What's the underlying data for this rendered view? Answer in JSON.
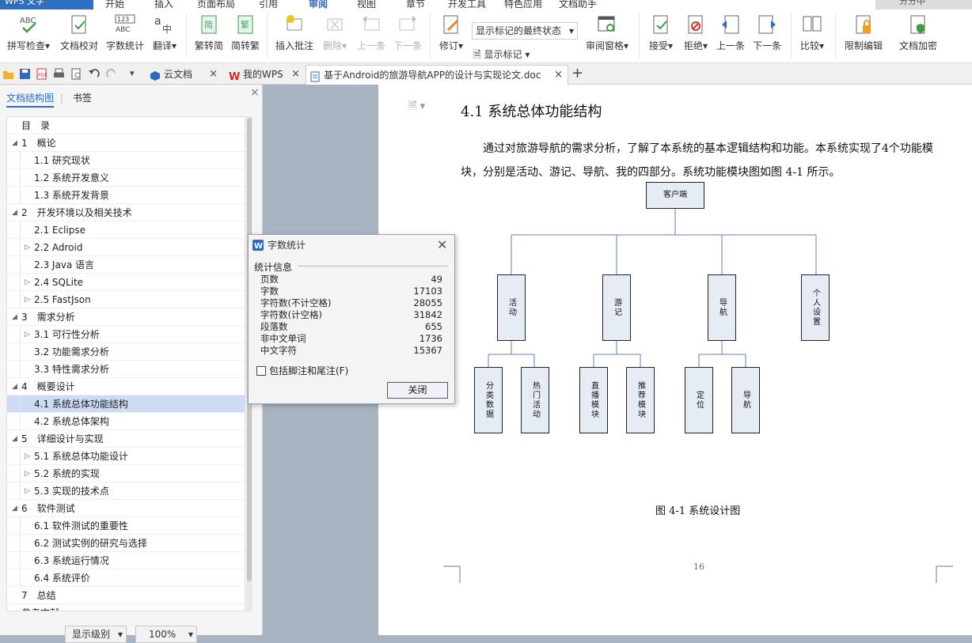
{
  "menubar": {
    "app_name": "WPS 文字",
    "tabs": [
      "开始",
      "插入",
      "页面布局",
      "引用",
      "审阅",
      "视图",
      "章节",
      "开发工具",
      "特色应用",
      "文档助手"
    ],
    "active_tab": "审阅",
    "user": "分分中"
  },
  "ribbon": {
    "spell_check": "拼写检查",
    "doc_proof": "文档校对",
    "word_count": "字数统计",
    "translate": "翻译",
    "to_traditional": "繁转简",
    "to_simplified": "简转繁",
    "insert_comment": "插入批注",
    "delete": "删除",
    "prev": "上一条",
    "next": "下一条",
    "revise": "修订",
    "markup_state": "显示标记的最终状态",
    "show_markup": "显示标记",
    "review_pane": "审阅窗格",
    "accept": "接受",
    "reject": "拒绝",
    "prev2": "上一条",
    "next2": "下一条",
    "compare": "比较",
    "restrict_edit": "限制编辑",
    "doc_encrypt": "文档加密"
  },
  "tabs": [
    {
      "label": "云文档",
      "close": "×"
    },
    {
      "label": "我的WPS",
      "close": "×"
    },
    {
      "label": "基于Android的旅游导航APP的设计与实现论文.doc",
      "close": "×"
    }
  ],
  "new_tab": "+",
  "nav": {
    "tab_outline": "文档结构图",
    "tab_bookmark": "书签",
    "close": "×",
    "items": [
      {
        "level": 0,
        "arrow": "",
        "label": "目　录"
      },
      {
        "level": 0,
        "arrow": "◢",
        "label": "1　概论"
      },
      {
        "level": 1,
        "arrow": "",
        "label": "1.1  研究现状"
      },
      {
        "level": 1,
        "arrow": "",
        "label": "1.2  系统开发意义"
      },
      {
        "level": 1,
        "arrow": "",
        "label": "1.3  系统开发背景"
      },
      {
        "level": 0,
        "arrow": "◢",
        "label": "2　开发环境以及相关技术"
      },
      {
        "level": 1,
        "arrow": "",
        "label": "2.1 Eclipse"
      },
      {
        "level": 1,
        "arrow": "▷",
        "label": "2.2 Adroid"
      },
      {
        "level": 1,
        "arrow": "",
        "label": "2.3 Java 语言"
      },
      {
        "level": 1,
        "arrow": "▷",
        "label": "2.4 SQLite"
      },
      {
        "level": 1,
        "arrow": "▷",
        "label": "2.5 FastJson"
      },
      {
        "level": 0,
        "arrow": "◢",
        "label": "3　需求分析"
      },
      {
        "level": 1,
        "arrow": "▷",
        "label": "3.1  可行性分析"
      },
      {
        "level": 1,
        "arrow": "",
        "label": "3.2  功能需求分析"
      },
      {
        "level": 1,
        "arrow": "",
        "label": "3.3  特性需求分析"
      },
      {
        "level": 0,
        "arrow": "◢",
        "label": "4　概要设计"
      },
      {
        "level": 1,
        "arrow": "",
        "label": "4.1  系统总体功能结构",
        "selected": true
      },
      {
        "level": 1,
        "arrow": "",
        "label": "4.2  系统总体架构"
      },
      {
        "level": 0,
        "arrow": "◢",
        "label": "5　详细设计与实现"
      },
      {
        "level": 1,
        "arrow": "▷",
        "label": "5.1  系统总体功能设计"
      },
      {
        "level": 1,
        "arrow": "▷",
        "label": "5.2  系统的实现"
      },
      {
        "level": 1,
        "arrow": "▷",
        "label": "5.3  实现的技术点"
      },
      {
        "level": 0,
        "arrow": "◢",
        "label": "6　软件测试"
      },
      {
        "level": 1,
        "arrow": "",
        "label": "6.1  软件测试的重要性"
      },
      {
        "level": 1,
        "arrow": "",
        "label": "6.2  测试实例的研究与选择"
      },
      {
        "level": 1,
        "arrow": "",
        "label": "6.3  系统运行情况"
      },
      {
        "level": 1,
        "arrow": "",
        "label": "6.4  系统评价"
      },
      {
        "level": 0,
        "arrow": "",
        "label": "7　总结"
      },
      {
        "level": 0,
        "arrow": "",
        "label": "参考文献"
      }
    ],
    "level_select": "显示级别",
    "zoom_select": "100%"
  },
  "page": {
    "heading": "4.1  系统总体功能结构",
    "paragraph": "通过对旅游导航的需求分析，了解了本系统的基本逻辑结构和功能。本系统实现了4个功能模块，分别是活动、游记、导航、我的四部分。系统功能模块图如图 4-1 所示。",
    "figure": {
      "root": "客户端",
      "modules": [
        "活动",
        "游记",
        "导航",
        "个人设置"
      ],
      "subs": [
        [
          "分类数据",
          "热门活动"
        ],
        [
          "直播模块",
          "推荐模块"
        ],
        [
          "定位",
          "导航"
        ]
      ]
    },
    "caption": "图 4-1 系统设计图",
    "page_number": "16"
  },
  "dialog": {
    "title": "字数统计",
    "section": "统计信息",
    "stats": [
      {
        "label": "页数",
        "value": "49"
      },
      {
        "label": "字数",
        "value": "17103"
      },
      {
        "label": "字符数(不计空格)",
        "value": "28055"
      },
      {
        "label": "字符数(计空格)",
        "value": "31842"
      },
      {
        "label": "段落数",
        "value": "655"
      },
      {
        "label": "非中文单词",
        "value": "1736"
      },
      {
        "label": "中文字符",
        "value": "15367"
      }
    ],
    "include_footnotes": "包括脚注和尾注(F)",
    "close_button": "关闭"
  },
  "colors": {
    "accent": "#2b6bc5",
    "selection": "#cddcf3",
    "figure_fill": "#e6ecf4",
    "connector": "#5b7fbf"
  }
}
